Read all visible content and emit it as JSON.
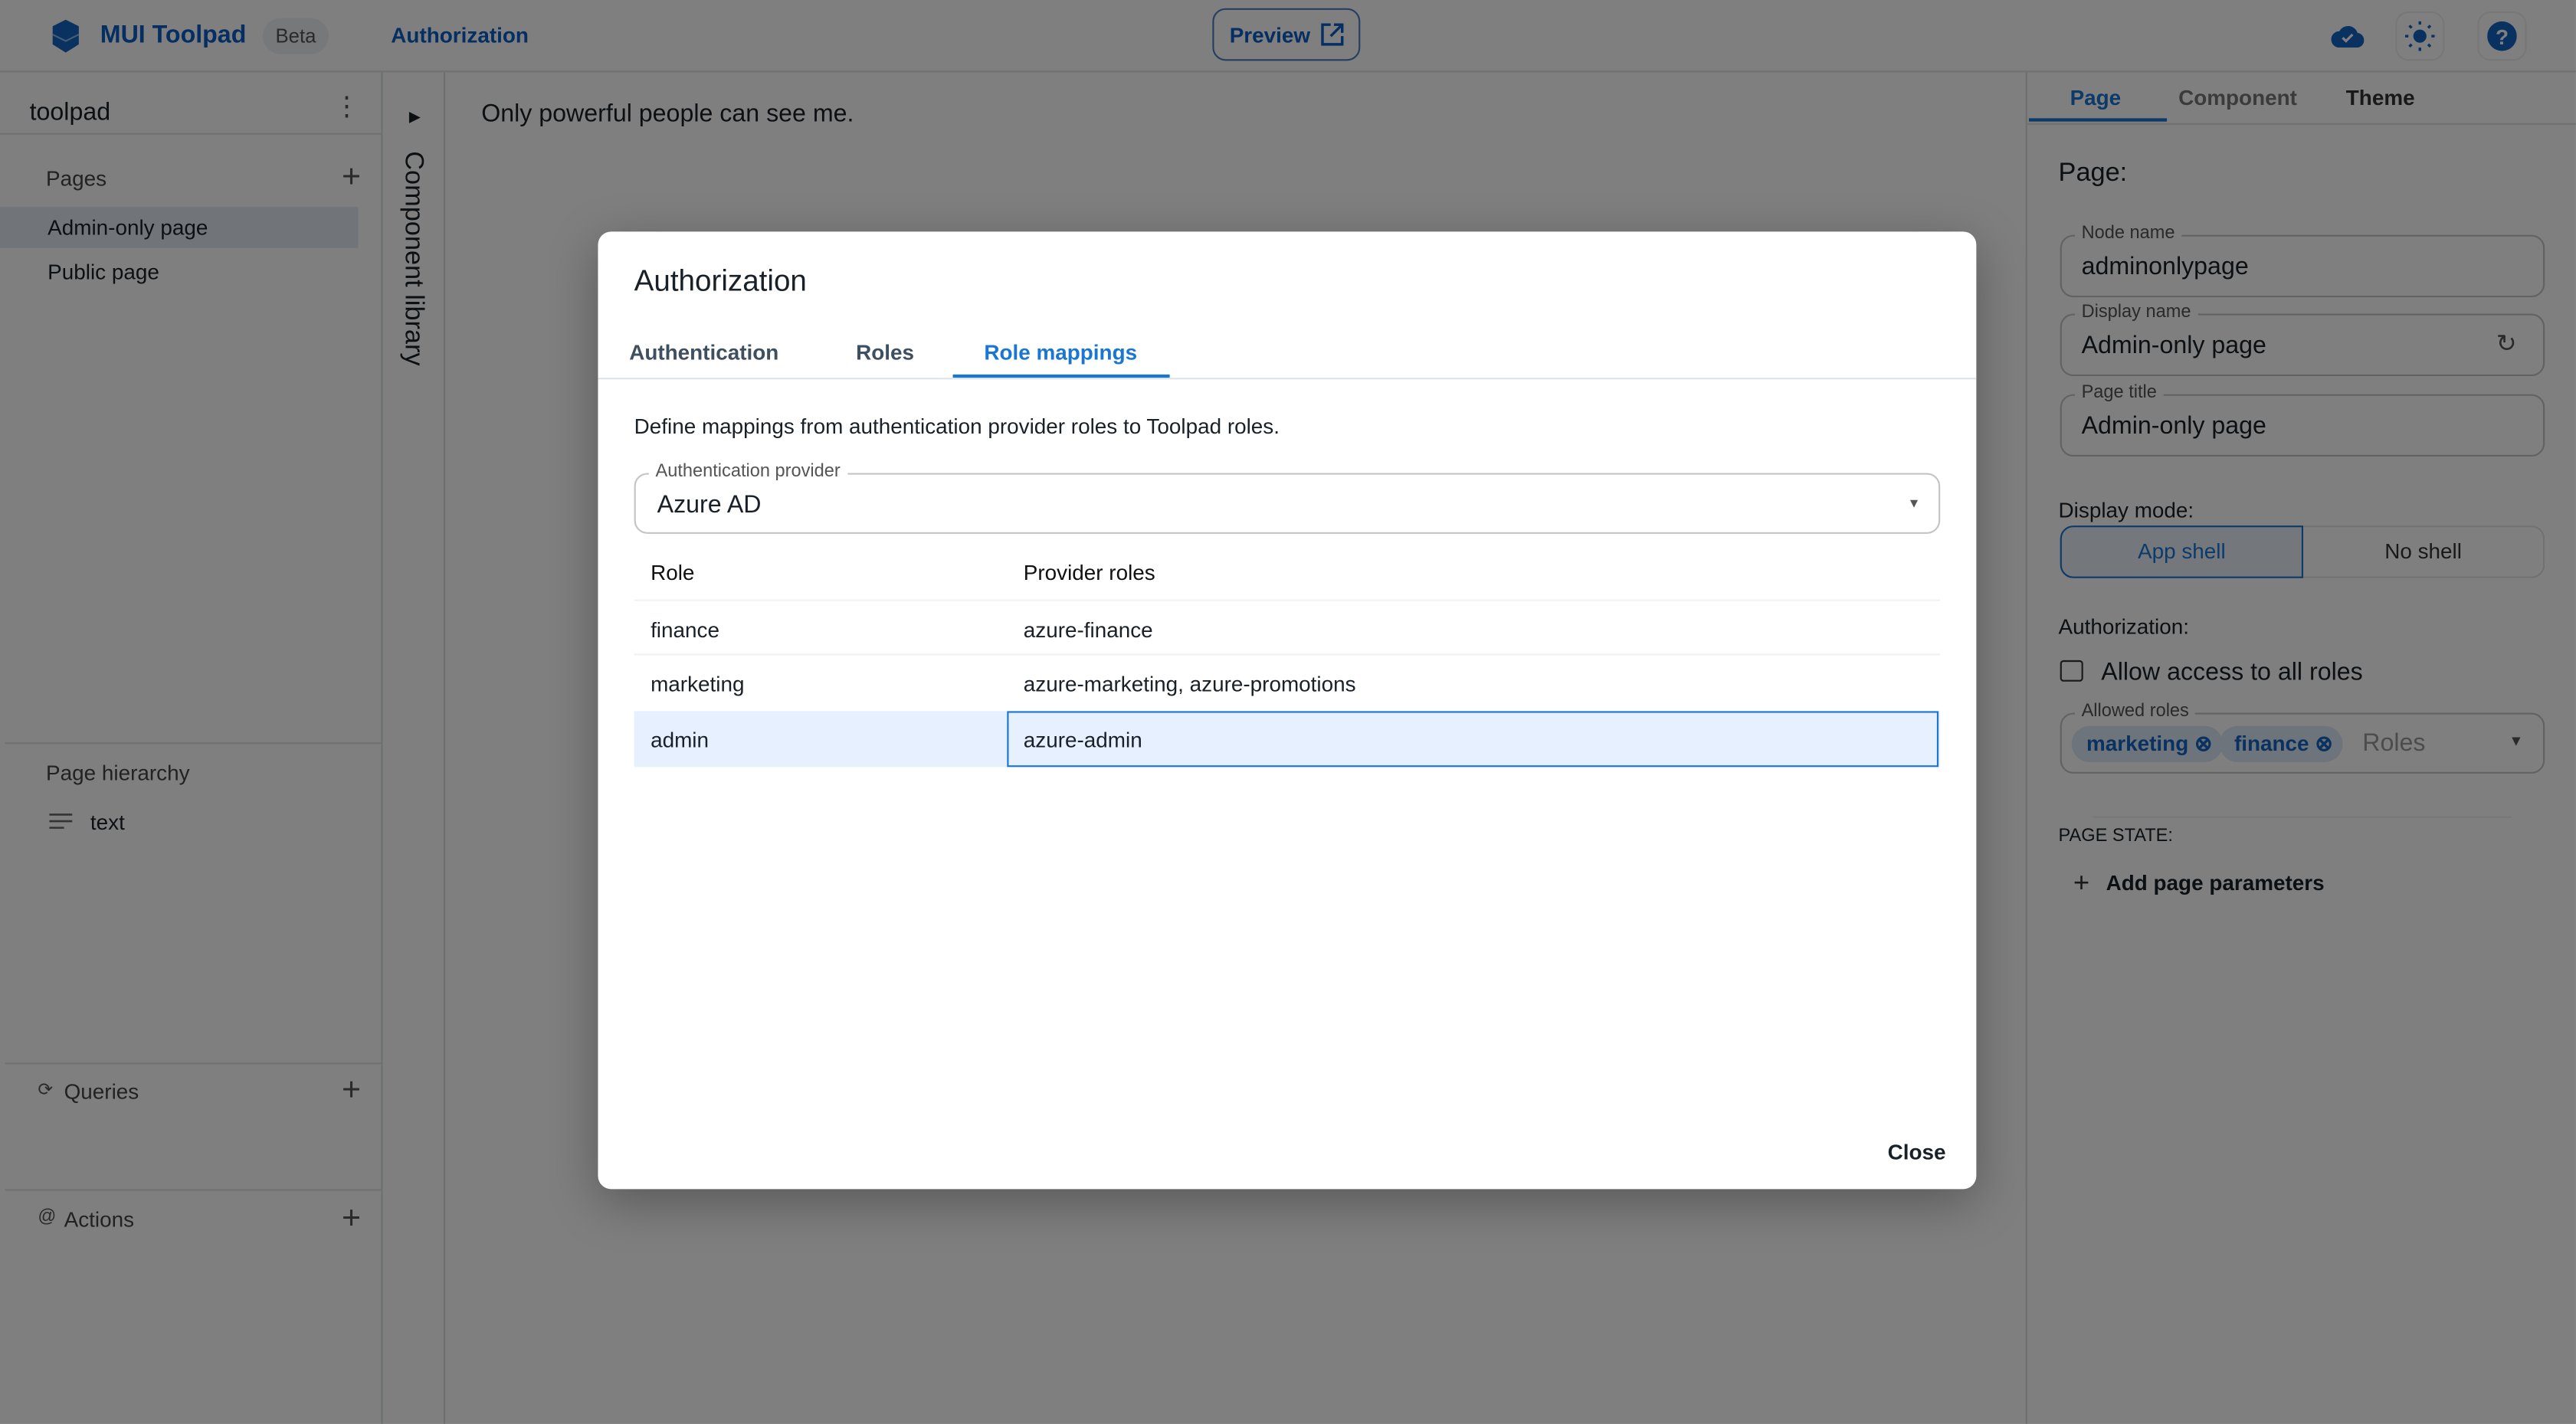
{
  "header": {
    "app_name": "MUI Toolpad",
    "beta": "Beta",
    "nav_link": "Authorization",
    "preview": "Preview"
  },
  "sidebar": {
    "project": "toolpad",
    "pages_label": "Pages",
    "pages": [
      {
        "label": "Admin-only page",
        "selected": true
      },
      {
        "label": "Public page",
        "selected": false
      }
    ],
    "hierarchy_label": "Page hierarchy",
    "hierarchy_items": [
      "text"
    ],
    "queries_label": "Queries",
    "actions_label": "Actions"
  },
  "component_library": "Component library",
  "canvas": {
    "text": "Only powerful people can see me."
  },
  "inspector": {
    "tabs": [
      "Page",
      "Component",
      "Theme"
    ],
    "active_tab": "Page",
    "heading": "Page:",
    "node_name_label": "Node name",
    "node_name": "adminonlypage",
    "display_name_label": "Display name",
    "display_name": "Admin-only page",
    "page_title_label": "Page title",
    "page_title": "Admin-only page",
    "display_mode_label": "Display mode:",
    "display_modes": [
      "App shell",
      "No shell"
    ],
    "selected_mode": "App shell",
    "authorization_label": "Authorization:",
    "allow_all_label": "Allow access to all roles",
    "allow_all_checked": false,
    "allowed_roles_label": "Allowed roles",
    "allowed_roles": [
      "marketing",
      "finance"
    ],
    "roles_placeholder": "Roles",
    "page_state_label": "PAGE STATE:",
    "add_params": "Add page parameters"
  },
  "dialog": {
    "title": "Authorization",
    "tabs": [
      "Authentication",
      "Roles",
      "Role mappings"
    ],
    "active_tab": "Role mappings",
    "description": "Define mappings from authentication provider roles to Toolpad roles.",
    "provider_label": "Authentication provider",
    "provider_value": "Azure AD",
    "columns": [
      "Role",
      "Provider roles"
    ],
    "rows": [
      {
        "role": "finance",
        "provider_roles": "azure-finance"
      },
      {
        "role": "marketing",
        "provider_roles": "azure-marketing, azure-promotions"
      },
      {
        "role": "admin",
        "provider_roles": "azure-admin"
      }
    ],
    "close": "Close"
  },
  "colors": {
    "primary": "#0b5cc5",
    "accent": "#1976d2",
    "selected_row": "#e6f0ff",
    "backdrop": "rgba(0,0,0,0.5)"
  }
}
